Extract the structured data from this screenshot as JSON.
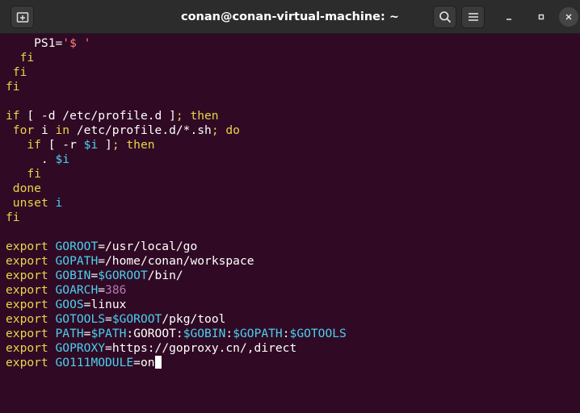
{
  "window": {
    "title": "conan@conan-virtual-machine: ~",
    "icons": {
      "new_tab": "new-tab-icon",
      "search": "search-icon",
      "menu": "hamburger-menu-icon",
      "minimize": "minimize-icon",
      "maximize": "maximize-icon",
      "close": "close-icon"
    }
  },
  "colors": {
    "background": "#300a24",
    "text": "#ffffff",
    "keyword": "#e9d44a",
    "variable": "#4ad0f0",
    "string": "#ff7f7f",
    "number": "#b07ab5",
    "titlebar": "#2c2c2c"
  },
  "terminal": {
    "lines": [
      [
        {
          "t": "    PS1=",
          "c": "txt"
        },
        {
          "t": "'$ '",
          "c": "str"
        }
      ],
      [
        {
          "t": "  ",
          "c": "txt"
        },
        {
          "t": "fi",
          "c": "kw"
        }
      ],
      [
        {
          "t": " ",
          "c": "txt"
        },
        {
          "t": "fi",
          "c": "kw"
        }
      ],
      [
        {
          "t": "fi",
          "c": "kw"
        }
      ],
      [],
      [
        {
          "t": "if",
          "c": "kw"
        },
        {
          "t": " [ -d /etc/profile.d ]",
          "c": "txt"
        },
        {
          "t": "; then",
          "c": "kw"
        }
      ],
      [
        {
          "t": " ",
          "c": "txt"
        },
        {
          "t": "for",
          "c": "kw"
        },
        {
          "t": " i ",
          "c": "txt"
        },
        {
          "t": "in",
          "c": "kw"
        },
        {
          "t": " /etc/profile.d/*.sh",
          "c": "txt"
        },
        {
          "t": "; do",
          "c": "kw"
        }
      ],
      [
        {
          "t": "   ",
          "c": "txt"
        },
        {
          "t": "if",
          "c": "kw"
        },
        {
          "t": " [ -r ",
          "c": "txt"
        },
        {
          "t": "$i",
          "c": "var"
        },
        {
          "t": " ]",
          "c": "txt"
        },
        {
          "t": "; then",
          "c": "kw"
        }
      ],
      [
        {
          "t": "     . ",
          "c": "txt"
        },
        {
          "t": "$i",
          "c": "var"
        }
      ],
      [
        {
          "t": "   ",
          "c": "txt"
        },
        {
          "t": "fi",
          "c": "kw"
        }
      ],
      [
        {
          "t": " ",
          "c": "txt"
        },
        {
          "t": "done",
          "c": "kw"
        }
      ],
      [
        {
          "t": " ",
          "c": "txt"
        },
        {
          "t": "unset",
          "c": "kw"
        },
        {
          "t": " ",
          "c": "txt"
        },
        {
          "t": "i",
          "c": "var"
        }
      ],
      [
        {
          "t": "fi",
          "c": "kw"
        }
      ],
      [],
      [
        {
          "t": "export ",
          "c": "kw"
        },
        {
          "t": "GOROOT",
          "c": "var"
        },
        {
          "t": "=/usr/local/go",
          "c": "txt"
        }
      ],
      [
        {
          "t": "export ",
          "c": "kw"
        },
        {
          "t": "GOPATH",
          "c": "var"
        },
        {
          "t": "=/home/conan/workspace",
          "c": "txt"
        }
      ],
      [
        {
          "t": "export ",
          "c": "kw"
        },
        {
          "t": "GOBIN",
          "c": "var"
        },
        {
          "t": "=",
          "c": "txt"
        },
        {
          "t": "$GOROOT",
          "c": "var"
        },
        {
          "t": "/bin/",
          "c": "txt"
        }
      ],
      [
        {
          "t": "export ",
          "c": "kw"
        },
        {
          "t": "GOARCH",
          "c": "var"
        },
        {
          "t": "=",
          "c": "txt"
        },
        {
          "t": "386",
          "c": "num"
        }
      ],
      [
        {
          "t": "export ",
          "c": "kw"
        },
        {
          "t": "GOOS",
          "c": "var"
        },
        {
          "t": "=linux",
          "c": "txt"
        }
      ],
      [
        {
          "t": "export ",
          "c": "kw"
        },
        {
          "t": "GOTOOLS",
          "c": "var"
        },
        {
          "t": "=",
          "c": "txt"
        },
        {
          "t": "$GOROOT",
          "c": "var"
        },
        {
          "t": "/pkg/tool",
          "c": "txt"
        }
      ],
      [
        {
          "t": "export ",
          "c": "kw"
        },
        {
          "t": "PATH",
          "c": "var"
        },
        {
          "t": "=",
          "c": "txt"
        },
        {
          "t": "$PATH",
          "c": "var"
        },
        {
          "t": ":GOROOT:",
          "c": "txt"
        },
        {
          "t": "$GOBIN",
          "c": "var"
        },
        {
          "t": ":",
          "c": "txt"
        },
        {
          "t": "$GOPATH",
          "c": "var"
        },
        {
          "t": ":",
          "c": "txt"
        },
        {
          "t": "$GOTOOLS",
          "c": "var"
        }
      ],
      [
        {
          "t": "export ",
          "c": "kw"
        },
        {
          "t": "GOPROXY",
          "c": "var"
        },
        {
          "t": "=https://goproxy.cn/,direct",
          "c": "txt"
        }
      ],
      [
        {
          "t": "export ",
          "c": "kw"
        },
        {
          "t": "GO111MODULE",
          "c": "var"
        },
        {
          "t": "=on",
          "c": "txt"
        }
      ]
    ]
  }
}
